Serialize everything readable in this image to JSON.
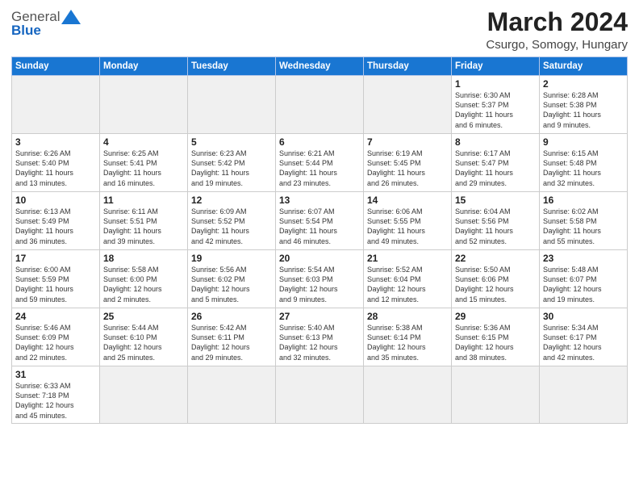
{
  "header": {
    "logo_general": "General",
    "logo_blue": "Blue",
    "month_year": "March 2024",
    "location": "Csurgo, Somogy, Hungary"
  },
  "weekdays": [
    "Sunday",
    "Monday",
    "Tuesday",
    "Wednesday",
    "Thursday",
    "Friday",
    "Saturday"
  ],
  "weeks": [
    [
      {
        "day": "",
        "info": ""
      },
      {
        "day": "",
        "info": ""
      },
      {
        "day": "",
        "info": ""
      },
      {
        "day": "",
        "info": ""
      },
      {
        "day": "",
        "info": ""
      },
      {
        "day": "1",
        "info": "Sunrise: 6:30 AM\nSunset: 5:37 PM\nDaylight: 11 hours\nand 6 minutes."
      },
      {
        "day": "2",
        "info": "Sunrise: 6:28 AM\nSunset: 5:38 PM\nDaylight: 11 hours\nand 9 minutes."
      }
    ],
    [
      {
        "day": "3",
        "info": "Sunrise: 6:26 AM\nSunset: 5:40 PM\nDaylight: 11 hours\nand 13 minutes."
      },
      {
        "day": "4",
        "info": "Sunrise: 6:25 AM\nSunset: 5:41 PM\nDaylight: 11 hours\nand 16 minutes."
      },
      {
        "day": "5",
        "info": "Sunrise: 6:23 AM\nSunset: 5:42 PM\nDaylight: 11 hours\nand 19 minutes."
      },
      {
        "day": "6",
        "info": "Sunrise: 6:21 AM\nSunset: 5:44 PM\nDaylight: 11 hours\nand 23 minutes."
      },
      {
        "day": "7",
        "info": "Sunrise: 6:19 AM\nSunset: 5:45 PM\nDaylight: 11 hours\nand 26 minutes."
      },
      {
        "day": "8",
        "info": "Sunrise: 6:17 AM\nSunset: 5:47 PM\nDaylight: 11 hours\nand 29 minutes."
      },
      {
        "day": "9",
        "info": "Sunrise: 6:15 AM\nSunset: 5:48 PM\nDaylight: 11 hours\nand 32 minutes."
      }
    ],
    [
      {
        "day": "10",
        "info": "Sunrise: 6:13 AM\nSunset: 5:49 PM\nDaylight: 11 hours\nand 36 minutes."
      },
      {
        "day": "11",
        "info": "Sunrise: 6:11 AM\nSunset: 5:51 PM\nDaylight: 11 hours\nand 39 minutes."
      },
      {
        "day": "12",
        "info": "Sunrise: 6:09 AM\nSunset: 5:52 PM\nDaylight: 11 hours\nand 42 minutes."
      },
      {
        "day": "13",
        "info": "Sunrise: 6:07 AM\nSunset: 5:54 PM\nDaylight: 11 hours\nand 46 minutes."
      },
      {
        "day": "14",
        "info": "Sunrise: 6:06 AM\nSunset: 5:55 PM\nDaylight: 11 hours\nand 49 minutes."
      },
      {
        "day": "15",
        "info": "Sunrise: 6:04 AM\nSunset: 5:56 PM\nDaylight: 11 hours\nand 52 minutes."
      },
      {
        "day": "16",
        "info": "Sunrise: 6:02 AM\nSunset: 5:58 PM\nDaylight: 11 hours\nand 55 minutes."
      }
    ],
    [
      {
        "day": "17",
        "info": "Sunrise: 6:00 AM\nSunset: 5:59 PM\nDaylight: 11 hours\nand 59 minutes."
      },
      {
        "day": "18",
        "info": "Sunrise: 5:58 AM\nSunset: 6:00 PM\nDaylight: 12 hours\nand 2 minutes."
      },
      {
        "day": "19",
        "info": "Sunrise: 5:56 AM\nSunset: 6:02 PM\nDaylight: 12 hours\nand 5 minutes."
      },
      {
        "day": "20",
        "info": "Sunrise: 5:54 AM\nSunset: 6:03 PM\nDaylight: 12 hours\nand 9 minutes."
      },
      {
        "day": "21",
        "info": "Sunrise: 5:52 AM\nSunset: 6:04 PM\nDaylight: 12 hours\nand 12 minutes."
      },
      {
        "day": "22",
        "info": "Sunrise: 5:50 AM\nSunset: 6:06 PM\nDaylight: 12 hours\nand 15 minutes."
      },
      {
        "day": "23",
        "info": "Sunrise: 5:48 AM\nSunset: 6:07 PM\nDaylight: 12 hours\nand 19 minutes."
      }
    ],
    [
      {
        "day": "24",
        "info": "Sunrise: 5:46 AM\nSunset: 6:09 PM\nDaylight: 12 hours\nand 22 minutes."
      },
      {
        "day": "25",
        "info": "Sunrise: 5:44 AM\nSunset: 6:10 PM\nDaylight: 12 hours\nand 25 minutes."
      },
      {
        "day": "26",
        "info": "Sunrise: 5:42 AM\nSunset: 6:11 PM\nDaylight: 12 hours\nand 29 minutes."
      },
      {
        "day": "27",
        "info": "Sunrise: 5:40 AM\nSunset: 6:13 PM\nDaylight: 12 hours\nand 32 minutes."
      },
      {
        "day": "28",
        "info": "Sunrise: 5:38 AM\nSunset: 6:14 PM\nDaylight: 12 hours\nand 35 minutes."
      },
      {
        "day": "29",
        "info": "Sunrise: 5:36 AM\nSunset: 6:15 PM\nDaylight: 12 hours\nand 38 minutes."
      },
      {
        "day": "30",
        "info": "Sunrise: 5:34 AM\nSunset: 6:17 PM\nDaylight: 12 hours\nand 42 minutes."
      }
    ],
    [
      {
        "day": "31",
        "info": "Sunrise: 6:33 AM\nSunset: 7:18 PM\nDaylight: 12 hours\nand 45 minutes."
      },
      {
        "day": "",
        "info": ""
      },
      {
        "day": "",
        "info": ""
      },
      {
        "day": "",
        "info": ""
      },
      {
        "day": "",
        "info": ""
      },
      {
        "day": "",
        "info": ""
      },
      {
        "day": "",
        "info": ""
      }
    ]
  ]
}
